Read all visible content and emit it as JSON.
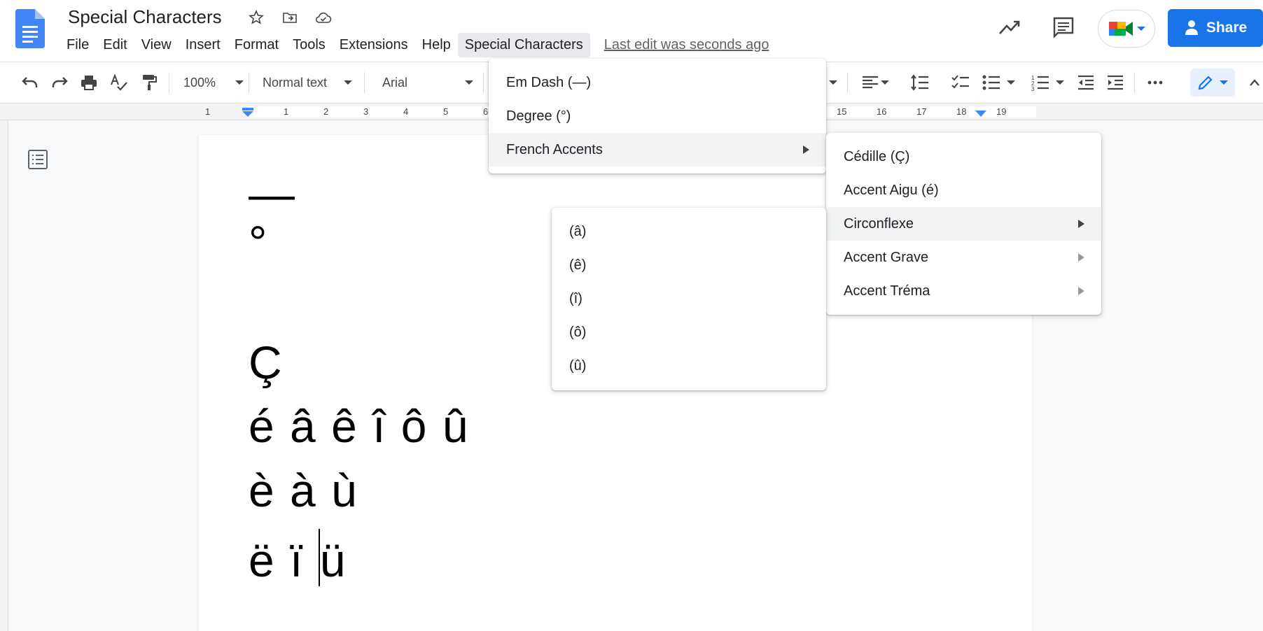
{
  "app": {
    "title": "Special Characters",
    "last_edit": "Last edit was seconds ago"
  },
  "menubar": {
    "items": [
      "File",
      "Edit",
      "View",
      "Insert",
      "Format",
      "Tools",
      "Extensions",
      "Help",
      "Special Characters"
    ],
    "active": "Special Characters"
  },
  "header": {
    "share_label": "Share"
  },
  "toolbar": {
    "zoom": "100%",
    "style": "Normal text",
    "font": "Arial"
  },
  "ruler": {
    "numbers": [
      "1",
      "1",
      "2",
      "3",
      "4",
      "5",
      "6",
      "15",
      "16",
      "17",
      "18",
      "19"
    ]
  },
  "document": {
    "lines": [
      "—",
      "°",
      "Ç",
      "é â ê î ô û",
      "è à ù"
    ],
    "last_line_before_cursor": "ë ï ",
    "last_line_after_cursor": "ü"
  },
  "menus": {
    "special_characters": {
      "items": [
        "Em Dash (—)",
        "Degree (°)",
        "French Accents"
      ]
    },
    "french_accents": {
      "items": [
        "Cédille (Ç)",
        "Accent Aigu (é)",
        "Circonflexe",
        "Accent Grave",
        "Accent Tréma"
      ]
    },
    "circonflexe": {
      "items": [
        "(â)",
        "(ê)",
        "(î)",
        "(ô)",
        "(û)"
      ]
    }
  },
  "colors": {
    "accent": "#1a73e8",
    "menu_highlight": "#f1f3f4"
  }
}
